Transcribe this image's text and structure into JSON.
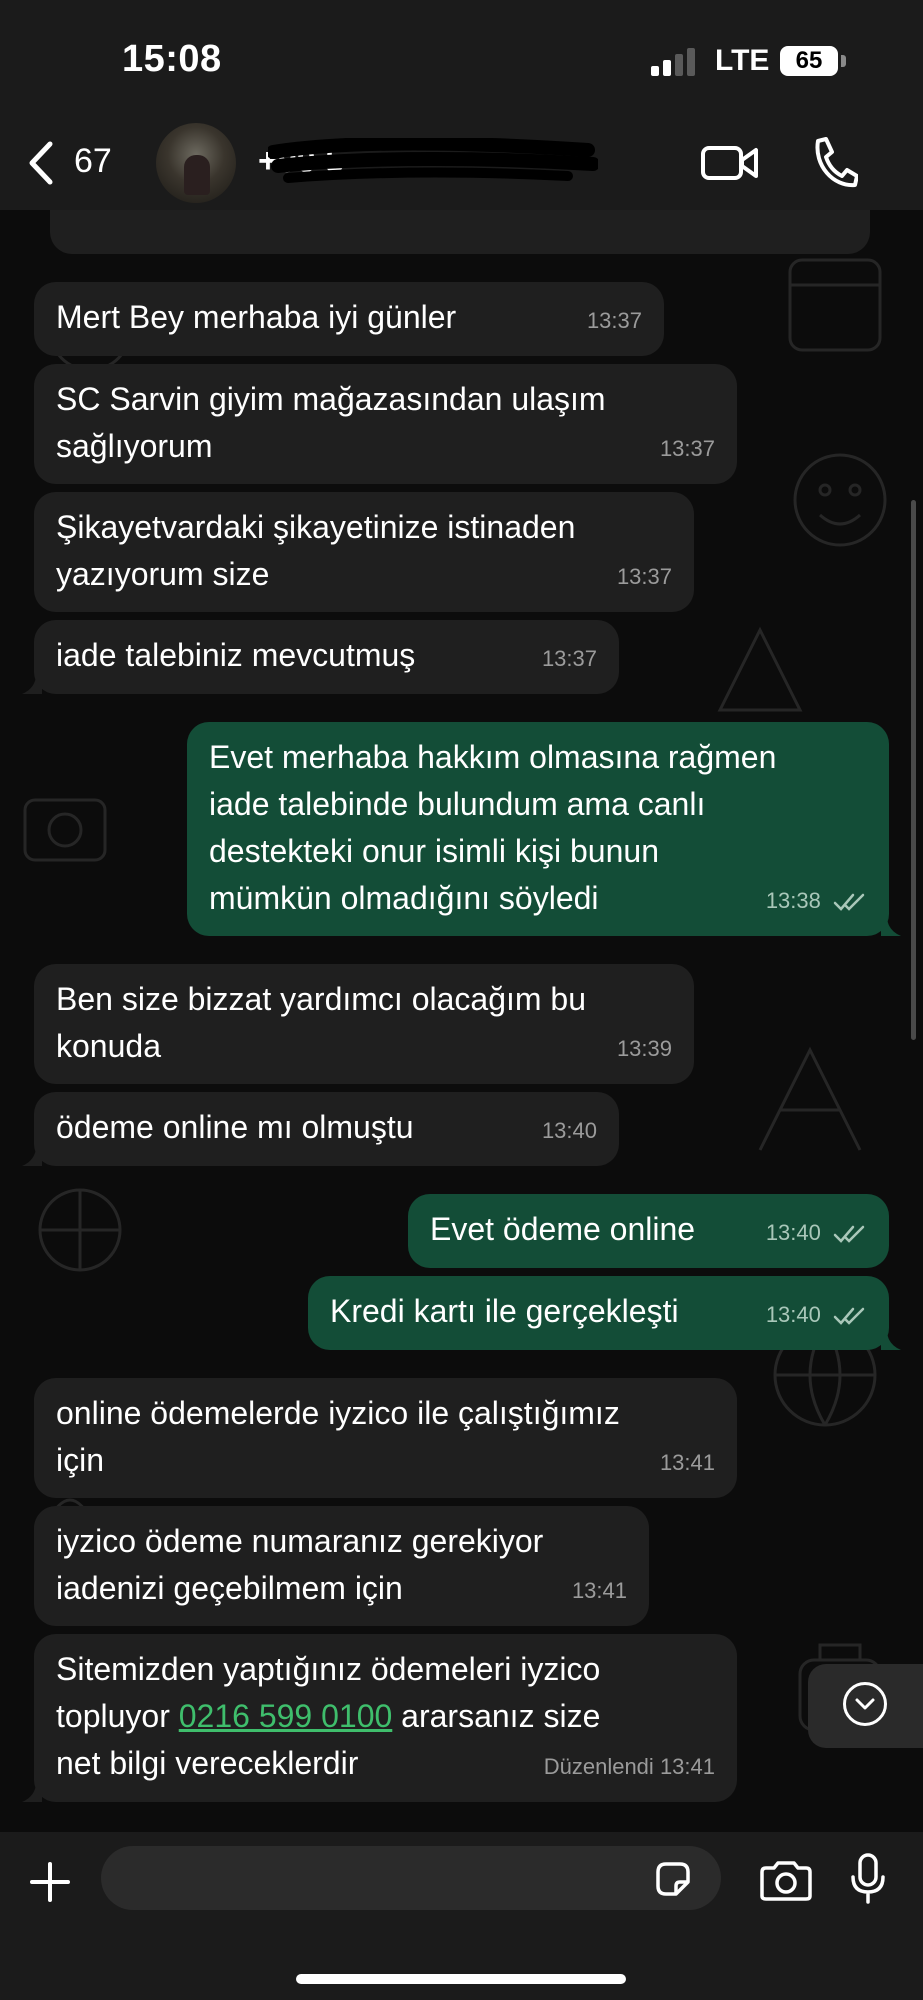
{
  "status_bar": {
    "time": "15:08",
    "network": "LTE",
    "battery": "65"
  },
  "header": {
    "back_count": "67",
    "contact_name": "+90 5•• ••• •• ••",
    "icons": [
      "chevron-left-icon",
      "video-call-icon",
      "phone-call-icon"
    ]
  },
  "messages": [
    {
      "direction": "in",
      "text": "Mert Bey merhaba iyi günler",
      "time": "13:37"
    },
    {
      "direction": "in",
      "text": "SC Sarvin giyim mağazasından ulaşım\nsağlıyorum",
      "time": "13:37"
    },
    {
      "direction": "in",
      "text": "Şikayetvardaki şikayetinize istinaden\nyazıyorum size",
      "time": "13:37"
    },
    {
      "direction": "in",
      "text": "iade talebiniz mevcutmuş",
      "time": "13:37"
    },
    {
      "direction": "out",
      "text": "Evet merhaba hakkım olmasına rağmen\niade talebinde bulundum ama canlı\ndestekteki onur isimli kişi bunun\nmümkün olmadığını söyledi",
      "time": "13:38"
    },
    {
      "direction": "in",
      "text": "Ben size bizzat yardımcı olacağım bu\nkonuda",
      "time": "13:39"
    },
    {
      "direction": "in",
      "text": "ödeme online mı olmuştu",
      "time": "13:40"
    },
    {
      "direction": "out",
      "text": "Evet ödeme online",
      "time": "13:40"
    },
    {
      "direction": "out",
      "text": "Kredi kartı ile gerçekleşti",
      "time": "13:40"
    },
    {
      "direction": "in",
      "text": "online ödemelerde iyzico ile çalıştığımız\niçin",
      "time": "13:41"
    },
    {
      "direction": "in",
      "text": "iyzico ödeme numaranız gerekiyor\niadenizi geçebilmem için",
      "time": "13:41"
    },
    {
      "direction": "in",
      "text_before": "Sitemizden yaptığınız ödemeleri iyzico\ntopluyor ",
      "phone": "0216 599 0100",
      "text_after": " ararsanız size\nnet bilgi vereceklerdir",
      "edited_label": "Düzenlendi",
      "time": "13:41"
    }
  ],
  "composer": {
    "placeholder": "",
    "icons": [
      "plus-icon",
      "sticker-icon",
      "camera-icon",
      "microphone-icon"
    ]
  },
  "colors": {
    "incoming_bubble": "#1f1f1f",
    "outgoing_bubble": "#134d37",
    "link": "#3fbe6c",
    "background": "#0b0b0b"
  }
}
